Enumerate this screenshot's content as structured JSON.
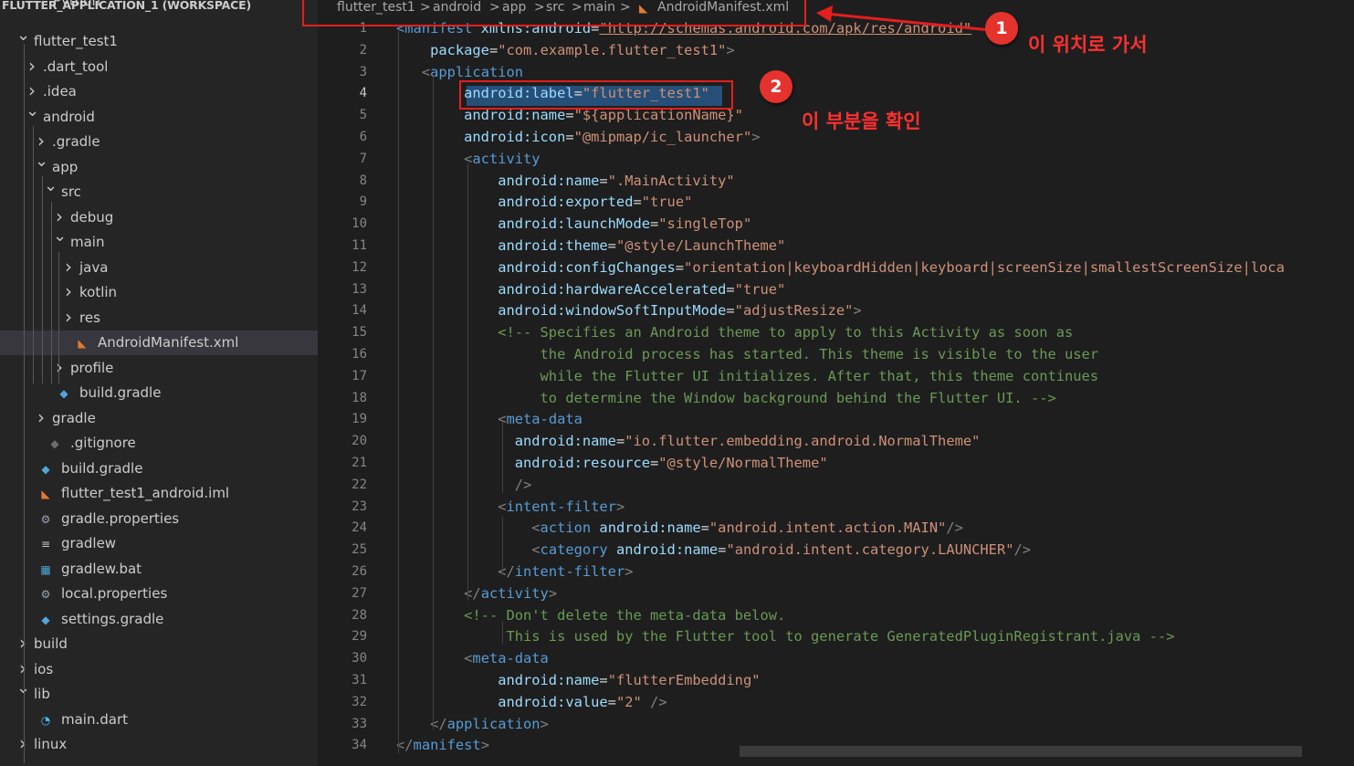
{
  "sidebar": {
    "workspace_title": "FLUTTER_APPLICATION_1 (WORKSPACE)",
    "partial_top_item": "Python",
    "tree": [
      {
        "label": "flutter_test1",
        "chevron": "down",
        "icon": "none"
      },
      {
        "label": ".dart_tool",
        "chevron": "right",
        "icon": "none"
      },
      {
        "label": ".idea",
        "chevron": "right",
        "icon": "none"
      },
      {
        "label": "android",
        "chevron": "down",
        "icon": "none"
      },
      {
        "label": ".gradle",
        "chevron": "right",
        "icon": "none"
      },
      {
        "label": "app",
        "chevron": "down",
        "icon": "none"
      },
      {
        "label": "src",
        "chevron": "down",
        "icon": "none"
      },
      {
        "label": "debug",
        "chevron": "right",
        "icon": "none"
      },
      {
        "label": "main",
        "chevron": "down",
        "icon": "none"
      },
      {
        "label": "java",
        "chevron": "right",
        "icon": "none"
      },
      {
        "label": "kotlin",
        "chevron": "right",
        "icon": "none"
      },
      {
        "label": "res",
        "chevron": "right",
        "icon": "none"
      },
      {
        "label": "AndroidManifest.xml",
        "chevron": "none",
        "icon": "rss-icon",
        "selected": true
      },
      {
        "label": "profile",
        "chevron": "right",
        "icon": "none"
      },
      {
        "label": "build.gradle",
        "chevron": "none",
        "icon": "gradle-elephant-icon"
      },
      {
        "label": "gradle",
        "chevron": "right",
        "icon": "none"
      },
      {
        "label": ".gitignore",
        "chevron": "none",
        "icon": "git-diamond-icon"
      },
      {
        "label": "build.gradle",
        "chevron": "none",
        "icon": "gradle-elephant-icon"
      },
      {
        "label": "flutter_test1_android.iml",
        "chevron": "none",
        "icon": "rss-icon"
      },
      {
        "label": "gradle.properties",
        "chevron": "none",
        "icon": "gear-icon"
      },
      {
        "label": "gradlew",
        "chevron": "none",
        "icon": "lines-icon"
      },
      {
        "label": "gradlew.bat",
        "chevron": "none",
        "icon": "windows-icon"
      },
      {
        "label": "local.properties",
        "chevron": "none",
        "icon": "gear-icon"
      },
      {
        "label": "settings.gradle",
        "chevron": "none",
        "icon": "gradle-elephant-icon"
      },
      {
        "label": "build",
        "chevron": "right",
        "icon": "none"
      },
      {
        "label": "ios",
        "chevron": "right",
        "icon": "none"
      },
      {
        "label": "lib",
        "chevron": "down",
        "icon": "none"
      },
      {
        "label": "main.dart",
        "chevron": "none",
        "icon": "dart-icon"
      },
      {
        "label": "linux",
        "chevron": "right",
        "icon": "none"
      }
    ]
  },
  "breadcrumb": {
    "items": [
      "flutter_test1",
      "android",
      "app",
      "src",
      "main",
      "AndroidManifest.xml"
    ],
    "separator": ">",
    "file_icon": "rss-icon"
  },
  "editor": {
    "active_line": 4,
    "lines": [
      {
        "n": "1",
        "tokens": [
          [
            "tag",
            "<manifest "
          ],
          [
            "attr",
            "xmlns:android"
          ],
          [
            "eq",
            "="
          ],
          [
            "url",
            "\"http://schemas.android.com/apk/res/android\""
          ],
          [
            "tag",
            ""
          ]
        ]
      },
      {
        "n": "2",
        "tokens": [
          [
            "text",
            "    "
          ],
          [
            "attr",
            "package"
          ],
          [
            "eq",
            "="
          ],
          [
            "val",
            "\"com.example.flutter_test1\""
          ],
          [
            "punc",
            ">"
          ]
        ]
      },
      {
        "n": "3",
        "tokens": [
          [
            "text",
            "   "
          ],
          [
            "punc",
            "<"
          ],
          [
            "tag",
            "application"
          ]
        ]
      },
      {
        "n": "4",
        "tokens": [
          [
            "text",
            "        "
          ],
          [
            "attr",
            "android:label"
          ],
          [
            "eq",
            "="
          ],
          [
            "val",
            "\"flutter_test1\""
          ]
        ]
      },
      {
        "n": "5",
        "tokens": [
          [
            "text",
            "        "
          ],
          [
            "attr",
            "android:name"
          ],
          [
            "eq",
            "="
          ],
          [
            "val",
            "\"${applicationName}\""
          ]
        ]
      },
      {
        "n": "6",
        "tokens": [
          [
            "text",
            "        "
          ],
          [
            "attr",
            "android:icon"
          ],
          [
            "eq",
            "="
          ],
          [
            "val",
            "\"@mipmap/ic_launcher\""
          ],
          [
            "punc",
            ">"
          ]
        ]
      },
      {
        "n": "7",
        "tokens": [
          [
            "text",
            "        "
          ],
          [
            "punc",
            "<"
          ],
          [
            "tag",
            "activity"
          ]
        ]
      },
      {
        "n": "8",
        "tokens": [
          [
            "text",
            "            "
          ],
          [
            "attr",
            "android:name"
          ],
          [
            "eq",
            "="
          ],
          [
            "val",
            "\".MainActivity\""
          ]
        ]
      },
      {
        "n": "9",
        "tokens": [
          [
            "text",
            "            "
          ],
          [
            "attr",
            "android:exported"
          ],
          [
            "eq",
            "="
          ],
          [
            "val",
            "\"true\""
          ]
        ]
      },
      {
        "n": "10",
        "tokens": [
          [
            "text",
            "            "
          ],
          [
            "attr",
            "android:launchMode"
          ],
          [
            "eq",
            "="
          ],
          [
            "val",
            "\"singleTop\""
          ]
        ]
      },
      {
        "n": "11",
        "tokens": [
          [
            "text",
            "            "
          ],
          [
            "attr",
            "android:theme"
          ],
          [
            "eq",
            "="
          ],
          [
            "val",
            "\"@style/LaunchTheme\""
          ]
        ]
      },
      {
        "n": "12",
        "tokens": [
          [
            "text",
            "            "
          ],
          [
            "attr",
            "android:configChanges"
          ],
          [
            "eq",
            "="
          ],
          [
            "val",
            "\"orientation|keyboardHidden|keyboard|screenSize|smallestScreenSize|loca"
          ]
        ]
      },
      {
        "n": "13",
        "tokens": [
          [
            "text",
            "            "
          ],
          [
            "attr",
            "android:hardwareAccelerated"
          ],
          [
            "eq",
            "="
          ],
          [
            "val",
            "\"true\""
          ]
        ]
      },
      {
        "n": "14",
        "tokens": [
          [
            "text",
            "            "
          ],
          [
            "attr",
            "android:windowSoftInputMode"
          ],
          [
            "eq",
            "="
          ],
          [
            "val",
            "\"adjustResize\""
          ],
          [
            "punc",
            ">"
          ]
        ]
      },
      {
        "n": "15",
        "tokens": [
          [
            "text",
            "            "
          ],
          [
            "com",
            "<!-- Specifies an Android theme to apply to this Activity as soon as"
          ]
        ]
      },
      {
        "n": "16",
        "tokens": [
          [
            "text",
            "                 "
          ],
          [
            "com",
            "the Android process has started. This theme is visible to the user"
          ]
        ]
      },
      {
        "n": "17",
        "tokens": [
          [
            "text",
            "                 "
          ],
          [
            "com",
            "while the Flutter UI initializes. After that, this theme continues"
          ]
        ]
      },
      {
        "n": "18",
        "tokens": [
          [
            "text",
            "                 "
          ],
          [
            "com",
            "to determine the Window background behind the Flutter UI. -->"
          ]
        ]
      },
      {
        "n": "19",
        "tokens": [
          [
            "text",
            "            "
          ],
          [
            "punc",
            "<"
          ],
          [
            "tag",
            "meta-data"
          ]
        ]
      },
      {
        "n": "20",
        "tokens": [
          [
            "text",
            "              "
          ],
          [
            "attr",
            "android:name"
          ],
          [
            "eq",
            "="
          ],
          [
            "val",
            "\"io.flutter.embedding.android.NormalTheme\""
          ]
        ]
      },
      {
        "n": "21",
        "tokens": [
          [
            "text",
            "              "
          ],
          [
            "attr",
            "android:resource"
          ],
          [
            "eq",
            "="
          ],
          [
            "val",
            "\"@style/NormalTheme\""
          ]
        ]
      },
      {
        "n": "22",
        "tokens": [
          [
            "text",
            "              "
          ],
          [
            "punc",
            "/>"
          ]
        ]
      },
      {
        "n": "23",
        "tokens": [
          [
            "text",
            "            "
          ],
          [
            "punc",
            "<"
          ],
          [
            "tag",
            "intent-filter"
          ],
          [
            "punc",
            ">"
          ]
        ]
      },
      {
        "n": "24",
        "tokens": [
          [
            "text",
            "                "
          ],
          [
            "punc",
            "<"
          ],
          [
            "tag",
            "action "
          ],
          [
            "attr",
            "android:name"
          ],
          [
            "eq",
            "="
          ],
          [
            "val",
            "\"android.intent.action.MAIN\""
          ],
          [
            "punc",
            "/>"
          ]
        ]
      },
      {
        "n": "25",
        "tokens": [
          [
            "text",
            "                "
          ],
          [
            "punc",
            "<"
          ],
          [
            "tag",
            "category "
          ],
          [
            "attr",
            "android:name"
          ],
          [
            "eq",
            "="
          ],
          [
            "val",
            "\"android.intent.category.LAUNCHER\""
          ],
          [
            "punc",
            "/>"
          ]
        ]
      },
      {
        "n": "26",
        "tokens": [
          [
            "text",
            "            "
          ],
          [
            "punc",
            "</"
          ],
          [
            "tag",
            "intent-filter"
          ],
          [
            "punc",
            ">"
          ]
        ]
      },
      {
        "n": "27",
        "tokens": [
          [
            "text",
            "        "
          ],
          [
            "punc",
            "</"
          ],
          [
            "tag",
            "activity"
          ],
          [
            "punc",
            ">"
          ]
        ]
      },
      {
        "n": "28",
        "tokens": [
          [
            "text",
            "        "
          ],
          [
            "com",
            "<!-- Don't delete the meta-data below."
          ]
        ]
      },
      {
        "n": "29",
        "tokens": [
          [
            "text",
            "             "
          ],
          [
            "com",
            "This is used by the Flutter tool to generate GeneratedPluginRegistrant.java -->"
          ]
        ]
      },
      {
        "n": "30",
        "tokens": [
          [
            "text",
            "        "
          ],
          [
            "punc",
            "<"
          ],
          [
            "tag",
            "meta-data"
          ]
        ]
      },
      {
        "n": "31",
        "tokens": [
          [
            "text",
            "            "
          ],
          [
            "attr",
            "android:name"
          ],
          [
            "eq",
            "="
          ],
          [
            "val",
            "\"flutterEmbedding\""
          ]
        ]
      },
      {
        "n": "32",
        "tokens": [
          [
            "text",
            "            "
          ],
          [
            "attr",
            "android:value"
          ],
          [
            "eq",
            "="
          ],
          [
            "val",
            "\"2\""
          ],
          [
            "text",
            " "
          ],
          [
            "punc",
            "/>"
          ]
        ]
      },
      {
        "n": "33",
        "tokens": [
          [
            "text",
            "    "
          ],
          [
            "punc",
            "</"
          ],
          [
            "tag",
            "application"
          ],
          [
            "punc",
            ">"
          ]
        ]
      },
      {
        "n": "34",
        "tokens": [
          [
            "punc",
            "</"
          ],
          [
            "tag",
            "manifest"
          ],
          [
            "punc",
            ">"
          ]
        ]
      }
    ]
  },
  "annotations": {
    "badge1": "1",
    "badge2": "2",
    "note1": "이 위치로 가서",
    "note2": "이 부분을 확인",
    "color": "#e41e1e"
  },
  "colors": {
    "background": "#1e1e1e",
    "sidebar": "#252526",
    "selection": "#264f78",
    "selected_row": "#37373d",
    "annotation_red": "#e41e1e"
  }
}
